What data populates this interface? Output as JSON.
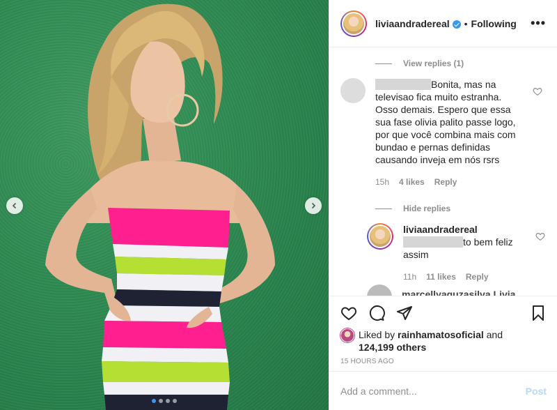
{
  "post": {
    "username": "liviaandradereal",
    "separator": "•",
    "follow_state": "Following",
    "more": "•••"
  },
  "carousel": {
    "dots_total": 4,
    "active_dot": 1
  },
  "comments": {
    "view_replies": "View replies (1)",
    "hide_replies": "Hide replies",
    "c1": {
      "text": "Bonita, mas na televisao fica muito estranha. Osso demais. Espero que essa sua fase olivia palito passe logo, por que você combina mais com bundao e pernas definidas causando inveja em nós rsrs",
      "time": "15h",
      "likes": "4 likes",
      "reply": "Reply"
    },
    "c2": {
      "username": "liviaandradereal",
      "text": "to bem feliz assim",
      "time": "11h",
      "likes": "11 likes",
      "reply": "Reply"
    },
    "c3": {
      "username_partial": "marcellyaquzasilva Livia"
    }
  },
  "likes": {
    "liked_by_prefix": "Liked by",
    "liker": "rainhamatosoficial",
    "and": "and",
    "others": "124,199 others"
  },
  "time_ago": "15 HOURS AGO",
  "comment_box": {
    "placeholder": "Add a comment...",
    "post_label": "Post"
  },
  "colors": {
    "accent_blue": "#3897f0",
    "post_disabled": "#b3dbff",
    "wall_green": "#2f8a52",
    "dress_pink": "#ff1f8e",
    "dress_lime": "#b5e033",
    "dress_navy": "#1e2233"
  },
  "icons": {
    "heart": "heart-icon",
    "comment": "comment-icon",
    "share": "share-icon",
    "bookmark": "bookmark-icon"
  }
}
